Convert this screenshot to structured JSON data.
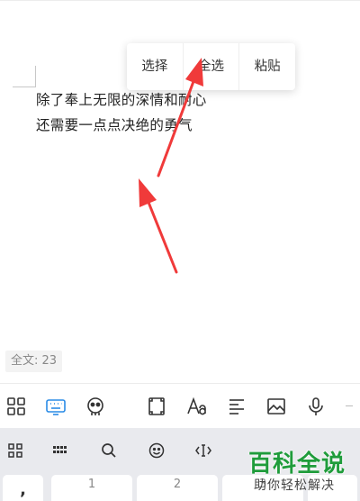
{
  "document": {
    "lines": [
      "除了奉上无限的深情和耐心",
      "还需要一点点决绝的勇气"
    ]
  },
  "context_menu": {
    "items": [
      "选择",
      "全选",
      "粘贴"
    ]
  },
  "word_count": "全文: 23",
  "toolbar": {
    "icons": [
      "app-grid-icon",
      "keyboard-icon",
      "emoji-face-icon",
      "crop-frame-icon",
      "font-style-icon",
      "align-icon",
      "image-icon",
      "microphone-icon"
    ]
  },
  "keyboard": {
    "toolbar_icons": [
      "grid-icon",
      "keyboard-layout-icon",
      "search-icon",
      "smiley-icon",
      "cursor-icon"
    ],
    "keys": [
      {
        "num": "",
        "sym": ","
      },
      {
        "num": "1",
        "sym": ""
      },
      {
        "num": "2",
        "sym": ""
      },
      {
        "num": "3",
        "sym": ""
      }
    ]
  },
  "watermark": {
    "title": "百科全说",
    "subtitle": "助你轻松解决"
  },
  "colors": {
    "arrow": "#f03a3a",
    "watermark_green": "#1f9c3b",
    "keyboard_bg": "#e9eaee"
  }
}
